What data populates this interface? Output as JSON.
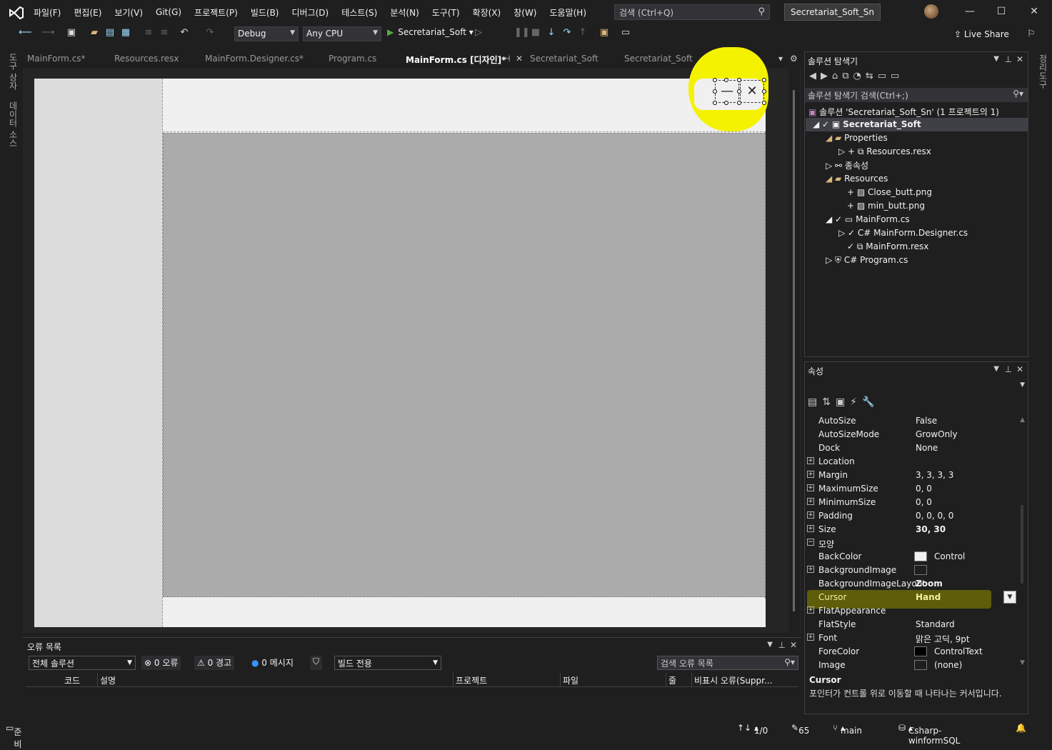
{
  "titlebar": {
    "menu": [
      "파일(F)",
      "편집(E)",
      "보기(V)",
      "Git(G)",
      "프로젝트(P)",
      "빌드(B)",
      "디버그(D)",
      "테스트(S)",
      "분석(N)",
      "도구(T)",
      "확장(X)",
      "창(W)",
      "도움말(H)"
    ],
    "search_placeholder": "검색 (Ctrl+Q)",
    "solution_name": "Secretariat_Soft_Sn"
  },
  "toolbar": {
    "config": "Debug",
    "platform": "Any CPU",
    "start_target": "Secretariat_Soft",
    "live_share": "Live Share"
  },
  "left_tabs": [
    "도구 상자",
    "데이터 소스"
  ],
  "doc_tabs": {
    "tabs": [
      "MainForm.cs*",
      "Resources.resx",
      "MainForm.Designer.cs*",
      "Program.cs",
      "MainForm.cs [디자인]*",
      "Secretariat_Soft",
      "Secretariat_Soft"
    ],
    "active_index": 4
  },
  "designer": {
    "min_glyph": "—",
    "close_glyph": "✕"
  },
  "error_list": {
    "title": "오류 목록",
    "scope": "전체 솔루션",
    "errors": "0 오류",
    "warnings": "0 경고",
    "messages": "0 메시지",
    "build_filter": "빌드 전용",
    "search_placeholder": "검색 오류 목록",
    "columns": [
      "코드",
      "설명",
      "프로젝트",
      "파일",
      "줄",
      "비표시 오류(Suppr..."
    ]
  },
  "solution_explorer": {
    "title": "솔루션 탐색기",
    "search_placeholder": "솔루션 탐색기 검색(Ctrl+;)",
    "items": [
      "솔루션 'Secretariat_Soft_Sn' (1 프로젝트의 1)",
      "Secretariat_Soft",
      "Properties",
      "Resources.resx",
      "종속성",
      "Resources",
      "Close_butt.png",
      "min_butt.png",
      "MainForm.cs",
      "MainForm.Designer.cs",
      "MainForm.resx",
      "Program.cs"
    ]
  },
  "properties": {
    "title": "속성",
    "rows": [
      {
        "name": "AutoSize",
        "value": "False",
        "expand": false
      },
      {
        "name": "AutoSizeMode",
        "value": "GrowOnly",
        "expand": false
      },
      {
        "name": "Dock",
        "value": "None",
        "expand": false
      },
      {
        "name": "Location",
        "value": "",
        "expand": true
      },
      {
        "name": "Margin",
        "value": "3, 3, 3, 3",
        "expand": true
      },
      {
        "name": "MaximumSize",
        "value": "0, 0",
        "expand": true
      },
      {
        "name": "MinimumSize",
        "value": "0, 0",
        "expand": true
      },
      {
        "name": "Padding",
        "value": "0, 0, 0, 0",
        "expand": true
      },
      {
        "name": "Size",
        "value": "30, 30",
        "expand": true
      },
      {
        "name": "모양",
        "value": "",
        "expand": true
      },
      {
        "name": "BackColor",
        "value": "Control",
        "expand": false
      },
      {
        "name": "BackgroundImage",
        "value": "",
        "expand": true
      },
      {
        "name": "BackgroundImageLayout",
        "value": "Zoom",
        "expand": false
      },
      {
        "name": "Cursor",
        "value": "Hand",
        "expand": false
      },
      {
        "name": "FlatAppearance",
        "value": "",
        "expand": true
      },
      {
        "name": "FlatStyle",
        "value": "Standard",
        "expand": false
      },
      {
        "name": "Font",
        "value": "맑은 고딕, 9pt",
        "expand": true
      },
      {
        "name": "ForeColor",
        "value": "ControlText",
        "expand": false
      },
      {
        "name": "Image",
        "value": "(none)",
        "expand": false
      }
    ],
    "desc_title": "Cursor",
    "desc_text": "포인터가 컨트롤 위로 이동할 때 나타나는 커서입니다."
  },
  "status": {
    "ready": "준비",
    "lines": "1/0",
    "edits": "65",
    "branch": "main",
    "repo": "Csharp-winformSQL"
  }
}
